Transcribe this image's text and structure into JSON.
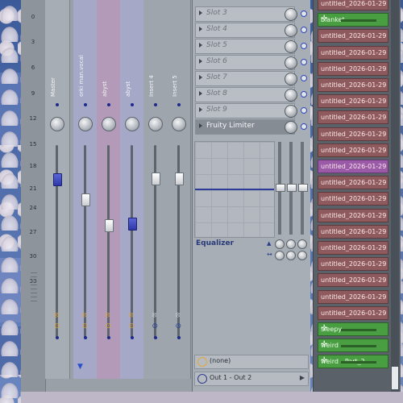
{
  "mixer": {
    "ruler_labels": [
      "0",
      "3",
      "6",
      "9",
      "12",
      "15",
      "18",
      "21",
      "24",
      "27",
      "30",
      "33"
    ],
    "tracks": [
      {
        "name": "Master",
        "color": "#a7adb5"
      },
      {
        "name": "orki man.vocal",
        "color": "#a6a8c8"
      },
      {
        "name": "abyst",
        "color": "#b39ab8"
      },
      {
        "name": "abyst",
        "color": "#a6a8c8"
      },
      {
        "name": "Insert 4",
        "color": "#9fa5ad"
      },
      {
        "name": "Insert 5",
        "color": "#9fa5ad"
      }
    ]
  },
  "fx": {
    "slots": [
      {
        "label": "Slot 3"
      },
      {
        "label": "Slot 4"
      },
      {
        "label": "Slot 5"
      },
      {
        "label": "Slot 6"
      },
      {
        "label": "Slot 7"
      },
      {
        "label": "Slot 8"
      },
      {
        "label": "Slot 9"
      },
      {
        "label": "Fruity Limiter"
      }
    ],
    "equalizer_label": "Equalizer",
    "input_label": "(none)",
    "output_label": "Out 1 - Out 2"
  },
  "playlist": {
    "clips": [
      {
        "label": "untitled_2026-01-29 01-...",
        "type": "audio"
      },
      {
        "label": "blanket",
        "type": "green"
      },
      {
        "label": "untitled_2026-01-29 01-...",
        "type": "audio"
      },
      {
        "label": "untitled_2026-01-29 01-...",
        "type": "audio"
      },
      {
        "label": "untitled_2026-01-29 01-...",
        "type": "audio"
      },
      {
        "label": "untitled_2026-01-29 01-...",
        "type": "audio"
      },
      {
        "label": "untitled_2026-01-29 01-...",
        "type": "audio"
      },
      {
        "label": "untitled_2026-01-29 01-...",
        "type": "audio"
      },
      {
        "label": "untitled_2026-01-29 01-...",
        "type": "audio"
      },
      {
        "label": "untitled_2026-01-29 01-...",
        "type": "audio"
      },
      {
        "label": "untitled_2026-01-29 01-...",
        "type": "purple"
      },
      {
        "label": "untitled_2026-01-29 01-...",
        "type": "audio"
      },
      {
        "label": "untitled_2026-01-29 01-...",
        "type": "audio"
      },
      {
        "label": "untitled_2026-01-29 01-...",
        "type": "audio"
      },
      {
        "label": "untitled_2026-01-29 01-...",
        "type": "audio"
      },
      {
        "label": "untitled_2026-01-29 01-...",
        "type": "audio"
      },
      {
        "label": "untitled_2026-01-29 01-...",
        "type": "audio"
      },
      {
        "label": "untitled_2026-01-29 01-...",
        "type": "audio"
      },
      {
        "label": "untitled_2026-01-29 01-...",
        "type": "audio"
      },
      {
        "label": "untitled_2026-01-29 01-...",
        "type": "audio"
      },
      {
        "label": "sleepy",
        "type": "green"
      },
      {
        "label": "weird",
        "type": "green"
      },
      {
        "label": "weird - Part_2",
        "type": "green"
      }
    ]
  }
}
